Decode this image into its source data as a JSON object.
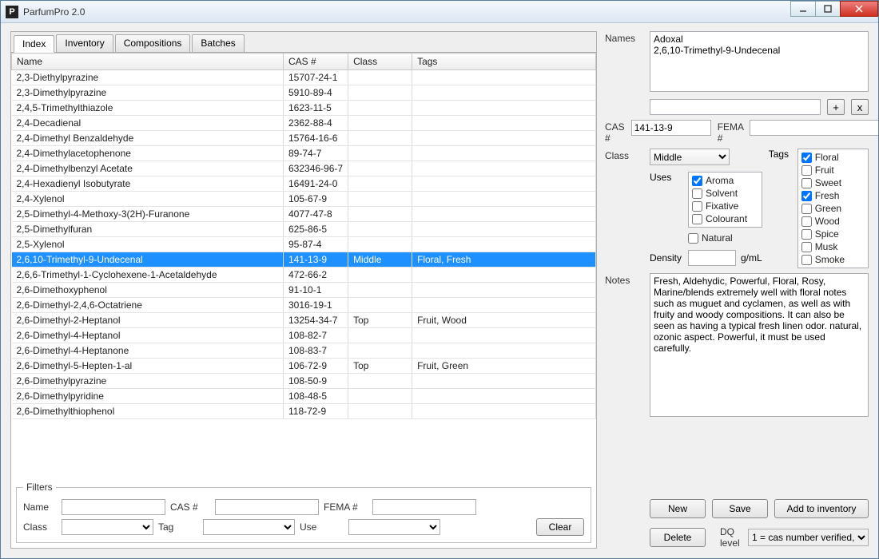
{
  "window": {
    "title": "ParfumPro 2.0",
    "appicon_letter": "P"
  },
  "tabs": [
    {
      "label": "Index",
      "active": true
    },
    {
      "label": "Inventory",
      "active": false
    },
    {
      "label": "Compositions",
      "active": false
    },
    {
      "label": "Batches",
      "active": false
    }
  ],
  "table": {
    "headers": [
      "Name",
      "CAS #",
      "Class",
      "Tags"
    ],
    "selected_index": 12,
    "rows": [
      {
        "name": "2,3-Diethylpyrazine",
        "cas": "15707-24-1",
        "class": "",
        "tags": ""
      },
      {
        "name": "2,3-Dimethylpyrazine",
        "cas": "5910-89-4",
        "class": "",
        "tags": ""
      },
      {
        "name": "2,4,5-Trimethylthiazole",
        "cas": "1623-11-5",
        "class": "",
        "tags": ""
      },
      {
        "name": "2,4-Decadienal",
        "cas": "2362-88-4",
        "class": "",
        "tags": ""
      },
      {
        "name": "2,4-Dimethyl Benzaldehyde",
        "cas": "15764-16-6",
        "class": "",
        "tags": ""
      },
      {
        "name": "2,4-Dimethylacetophenone",
        "cas": "89-74-7",
        "class": "",
        "tags": ""
      },
      {
        "name": "2,4-Dimethylbenzyl Acetate",
        "cas": "632346-96-7",
        "class": "",
        "tags": ""
      },
      {
        "name": "2,4-Hexadienyl Isobutyrate",
        "cas": "16491-24-0",
        "class": "",
        "tags": ""
      },
      {
        "name": "2,4-Xylenol",
        "cas": "105-67-9",
        "class": "",
        "tags": ""
      },
      {
        "name": "2,5-Dimethyl-4-Methoxy-3(2H)-Furanone",
        "cas": "4077-47-8",
        "class": "",
        "tags": ""
      },
      {
        "name": "2,5-Dimethylfuran",
        "cas": "625-86-5",
        "class": "",
        "tags": ""
      },
      {
        "name": "2,5-Xylenol",
        "cas": "95-87-4",
        "class": "",
        "tags": ""
      },
      {
        "name": "2,6,10-Trimethyl-9-Undecenal",
        "cas": "141-13-9",
        "class": "Middle",
        "tags": "Floral, Fresh"
      },
      {
        "name": "2,6,6-Trimethyl-1-Cyclohexene-1-Acetaldehyde",
        "cas": "472-66-2",
        "class": "",
        "tags": ""
      },
      {
        "name": "2,6-Dimethoxyphenol",
        "cas": "91-10-1",
        "class": "",
        "tags": ""
      },
      {
        "name": "2,6-Dimethyl-2,4,6-Octatriene",
        "cas": "3016-19-1",
        "class": "",
        "tags": ""
      },
      {
        "name": "2,6-Dimethyl-2-Heptanol",
        "cas": "13254-34-7",
        "class": "Top",
        "tags": "Fruit, Wood"
      },
      {
        "name": "2,6-Dimethyl-4-Heptanol",
        "cas": "108-82-7",
        "class": "",
        "tags": ""
      },
      {
        "name": "2,6-Dimethyl-4-Heptanone",
        "cas": "108-83-7",
        "class": "",
        "tags": ""
      },
      {
        "name": "2,6-Dimethyl-5-Hepten-1-al",
        "cas": "106-72-9",
        "class": "Top",
        "tags": "Fruit, Green"
      },
      {
        "name": "2,6-Dimethylpyrazine",
        "cas": "108-50-9",
        "class": "",
        "tags": ""
      },
      {
        "name": "2,6-Dimethylpyridine",
        "cas": "108-48-5",
        "class": "",
        "tags": ""
      },
      {
        "name": "2,6-Dimethylthiophenol",
        "cas": "118-72-9",
        "class": "",
        "tags": ""
      }
    ]
  },
  "filters": {
    "legend": "Filters",
    "labels": {
      "name": "Name",
      "cas": "CAS #",
      "fema": "FEMA #",
      "class": "Class",
      "tag": "Tag",
      "use": "Use"
    },
    "values": {
      "name": "",
      "cas": "",
      "fema": "",
      "class": "",
      "tag": "",
      "use": ""
    },
    "clear_label": "Clear"
  },
  "detail": {
    "labels": {
      "names": "Names",
      "cas": "CAS #",
      "fema": "FEMA #",
      "class": "Class",
      "tags": "Tags",
      "uses": "Uses",
      "natural": "Natural",
      "density": "Density",
      "density_unit": "g/mL",
      "notes": "Notes",
      "dq": "DQ level"
    },
    "names_text": "Adoxal\n2,6,10-Trimethyl-9-Undecenal",
    "names_new": "",
    "cas": "141-13-9",
    "fema": "",
    "class_value": "Middle",
    "uses": [
      {
        "label": "Aroma",
        "checked": true
      },
      {
        "label": "Solvent",
        "checked": false
      },
      {
        "label": "Fixative",
        "checked": false
      },
      {
        "label": "Colourant",
        "checked": false
      }
    ],
    "natural": false,
    "tags": [
      {
        "label": "Floral",
        "checked": true
      },
      {
        "label": "Fruit",
        "checked": false
      },
      {
        "label": "Sweet",
        "checked": false
      },
      {
        "label": "Fresh",
        "checked": true
      },
      {
        "label": "Green",
        "checked": false
      },
      {
        "label": "Wood",
        "checked": false
      },
      {
        "label": "Spice",
        "checked": false
      },
      {
        "label": "Musk",
        "checked": false
      },
      {
        "label": "Smoke",
        "checked": false
      }
    ],
    "density": "",
    "notes_text": "Fresh, Aldehydic, Powerful, Floral, Rosy, Marine/blends extremely well with floral notes such as muguet and cyclamen, as well as with fruity and woody compositions. It can also be seen as having a typical fresh linen odor. natural, ozonic aspect. Powerful, it must be used carefully.",
    "dq_value": "1 = cas number verified,",
    "buttons": {
      "new": "New",
      "save": "Save",
      "add_inv": "Add to inventory",
      "delete": "Delete",
      "plus": "+",
      "x": "x"
    }
  }
}
